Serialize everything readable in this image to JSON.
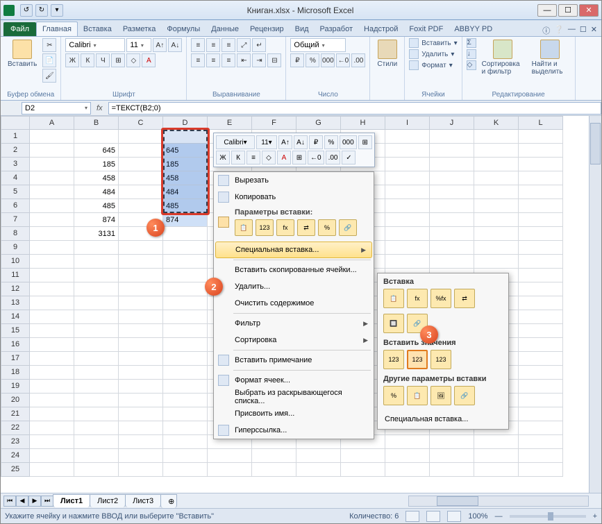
{
  "title": "Книган.xlsx - Microsoft Excel",
  "qat": [
    "↺",
    "↻",
    "▾"
  ],
  "win": {
    "min": "—",
    "max": "☐",
    "close": "✕"
  },
  "tabs": {
    "file": "Файл",
    "items": [
      "Главная",
      "Вставка",
      "Разметка",
      "Формулы",
      "Данные",
      "Рецензир",
      "Вид",
      "Разработ",
      "Надстрой",
      "Foxit PDF",
      "ABBYY PD"
    ],
    "active": 0,
    "help": [
      "ⓘ",
      "❔",
      "—",
      "☐",
      "✕"
    ]
  },
  "ribbon": {
    "clipboard": {
      "paste": "Вставить",
      "label": "Буфер обмена"
    },
    "font": {
      "name": "Calibri",
      "size": "11",
      "bold": "Ж",
      "italic": "К",
      "underline": "Ч",
      "label": "Шрифт"
    },
    "align": {
      "label": "Выравнивание"
    },
    "number": {
      "format": "Общий",
      "label": "Число"
    },
    "styles": {
      "btn": "Стили",
      "label": ""
    },
    "cells": {
      "insert": "Вставить",
      "delete": "Удалить",
      "format": "Формат",
      "label": "Ячейки"
    },
    "editing": {
      "sort": "Сортировка и фильтр",
      "find": "Найти и выделить",
      "label": "Редактирование"
    }
  },
  "name_box": "D2",
  "formula": "=ТЕКСТ(B2;0)",
  "columns": [
    "A",
    "B",
    "C",
    "D",
    "E",
    "F",
    "G",
    "H",
    "I",
    "J",
    "K",
    "L"
  ],
  "rows": 25,
  "data_b": [
    "645",
    "185",
    "458",
    "484",
    "485",
    "874",
    "3131"
  ],
  "data_d": [
    "645",
    "185",
    "458",
    "484",
    "485",
    "874"
  ],
  "mini_toolbar": {
    "font": "Calibri",
    "size": "11",
    "r1": [
      "A↑",
      "A↓",
      "₽",
      "%",
      "000",
      "⊞"
    ],
    "r2": [
      "Ж",
      "К",
      "≡",
      "◇",
      "A",
      "⊞",
      "←0",
      ".00",
      "✓"
    ]
  },
  "context_menu": [
    {
      "t": "item",
      "label": "Вырезать",
      "icon": true
    },
    {
      "t": "item",
      "label": "Копировать",
      "icon": true
    },
    {
      "t": "section",
      "label": "Параметры вставки:",
      "icon": true
    },
    {
      "t": "icons",
      "items": [
        "📋",
        "123",
        "fx",
        "⇄",
        "%",
        "🔗"
      ]
    },
    {
      "t": "item",
      "label": "Специальная вставка...",
      "hl": true,
      "arrow": true
    },
    {
      "t": "sep"
    },
    {
      "t": "item",
      "label": "Вставить скопированные ячейки..."
    },
    {
      "t": "item",
      "label": "Удалить..."
    },
    {
      "t": "item",
      "label": "Очистить содержимое"
    },
    {
      "t": "sep"
    },
    {
      "t": "item",
      "label": "Фильтр",
      "arrow": true
    },
    {
      "t": "item",
      "label": "Сортировка",
      "arrow": true
    },
    {
      "t": "sep"
    },
    {
      "t": "item",
      "label": "Вставить примечание",
      "icon": true
    },
    {
      "t": "sep"
    },
    {
      "t": "item",
      "label": "Формат ячеек...",
      "icon": true
    },
    {
      "t": "item",
      "label": "Выбрать из раскрывающегося списка..."
    },
    {
      "t": "item",
      "label": "Присвоить имя..."
    },
    {
      "t": "item",
      "label": "Гиперссылка...",
      "icon": true
    }
  ],
  "submenu": {
    "sec1": "Вставка",
    "icons1": [
      "📋",
      "fx",
      "%fx",
      "⇄"
    ],
    "icons1b": [
      "🔲",
      "🔗"
    ],
    "sec2": "Вставить значения",
    "icons2": [
      "123",
      "123",
      "123"
    ],
    "sec3": "Другие параметры вставки",
    "icons3": [
      "%",
      "📋",
      "🖼",
      "🔗"
    ],
    "special": "Специальная вставка..."
  },
  "badges": {
    "1": "1",
    "2": "2",
    "3": "3"
  },
  "sheets": {
    "nav": [
      "⏮",
      "◀",
      "▶",
      "⏭"
    ],
    "tabs": [
      "Лист1",
      "Лист2",
      "Лист3"
    ],
    "add": "⊕"
  },
  "status": {
    "msg": "Укажите ячейку и нажмите ВВОД или выберите \"Вставить\"",
    "count": "Количество: 6",
    "zoom": "100%",
    "views": [
      "▦",
      "▤",
      "▣"
    ],
    "minus": "—",
    "plus": "+"
  }
}
